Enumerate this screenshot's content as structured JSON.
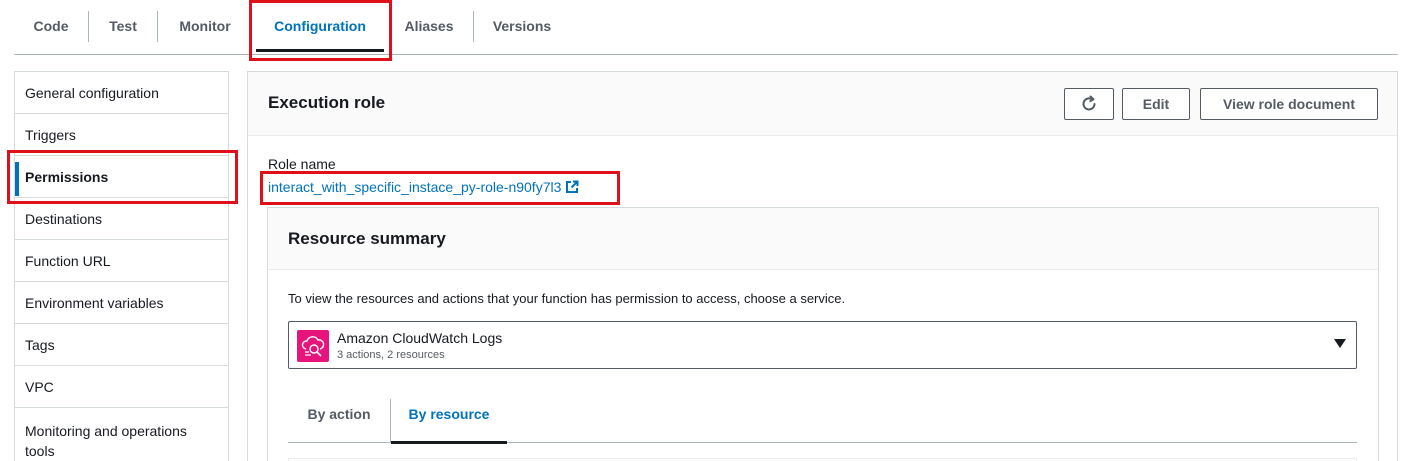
{
  "tabs": [
    {
      "label": "Code"
    },
    {
      "label": "Test"
    },
    {
      "label": "Monitor"
    },
    {
      "label": "Configuration"
    },
    {
      "label": "Aliases"
    },
    {
      "label": "Versions"
    }
  ],
  "sidebar": {
    "items": [
      {
        "label": "General configuration"
      },
      {
        "label": "Triggers"
      },
      {
        "label": "Permissions"
      },
      {
        "label": "Destinations"
      },
      {
        "label": "Function URL"
      },
      {
        "label": "Environment variables"
      },
      {
        "label": "Tags"
      },
      {
        "label": "VPC"
      },
      {
        "label": "Monitoring and operations tools"
      }
    ]
  },
  "execution_role": {
    "title": "Execution role",
    "edit_label": "Edit",
    "view_doc_label": "View role document",
    "role_name_label": "Role name",
    "role_name": "interact_with_specific_instace_py-role-n90fy7l3"
  },
  "resource_summary": {
    "title": "Resource summary",
    "description": "To view the resources and actions that your function has permission to access, choose a service.",
    "service": {
      "name": "Amazon CloudWatch Logs",
      "detail": "3 actions, 2 resources"
    },
    "tabs": [
      {
        "label": "By action"
      },
      {
        "label": "By resource"
      }
    ]
  },
  "colors": {
    "accent": "#0073bb",
    "highlight": "#e0101a",
    "service_icon": "#e7157b"
  }
}
